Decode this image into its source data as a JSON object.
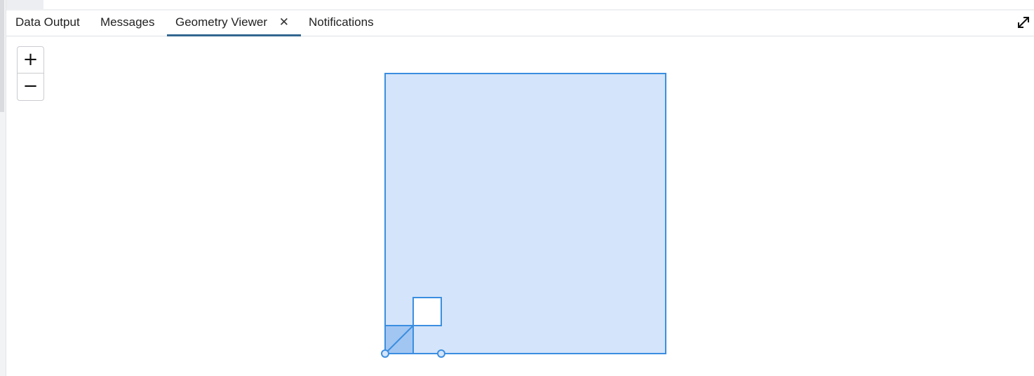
{
  "tabs": {
    "data_output": "Data Output",
    "messages": "Messages",
    "geometry_viewer": "Geometry Viewer",
    "geometry_viewer_close": "✕",
    "notifications": "Notifications",
    "active": "Geometry Viewer"
  },
  "toolbar": {
    "expand_icon": "expand-diagonal-icon"
  },
  "map": {
    "zoom_in_label": "+",
    "zoom_out_label": "−",
    "colors": {
      "stroke": "#3b8ee0",
      "fill_light": "#d4e4fa",
      "fill_dark": "#a2c6f2",
      "hole_fill": "#ffffff"
    }
  }
}
